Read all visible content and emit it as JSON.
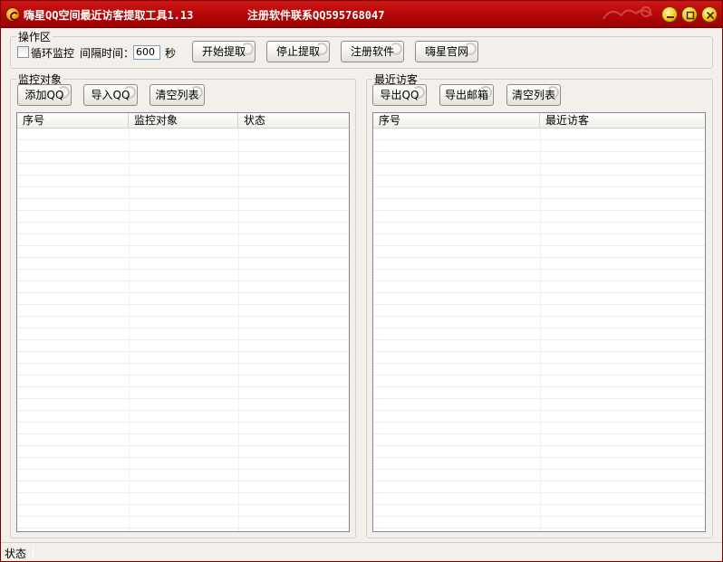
{
  "window": {
    "title": "嗨星QQ空间最近访客提取工具1.13",
    "title_contact": "注册软件联系QQ595768047"
  },
  "ops": {
    "group_title": "操作区",
    "loop_label": "循环监控",
    "interval_label": "间隔时间：",
    "interval_value": "600",
    "seconds_label": "秒",
    "start_label": "开始提取",
    "stop_label": "停止提取",
    "register_label": "注册软件",
    "website_label": "嗨星官网"
  },
  "monitor": {
    "group_title": "监控对象",
    "add_label": "添加QQ",
    "import_label": "导入QQ",
    "clear_label": "清空列表",
    "columns": [
      "序号",
      "监控对象",
      "状态"
    ]
  },
  "visitors": {
    "group_title": "最近访客",
    "export_qq_label": "导出QQ",
    "export_email_label": "导出邮箱",
    "clear_label": "清空列表",
    "columns": [
      "序号",
      "最近访客"
    ]
  },
  "status": {
    "text": "状态"
  },
  "colors": {
    "titlebar": "#b80808",
    "window_bg": "#f3f0ec",
    "list_border": "#828790"
  }
}
